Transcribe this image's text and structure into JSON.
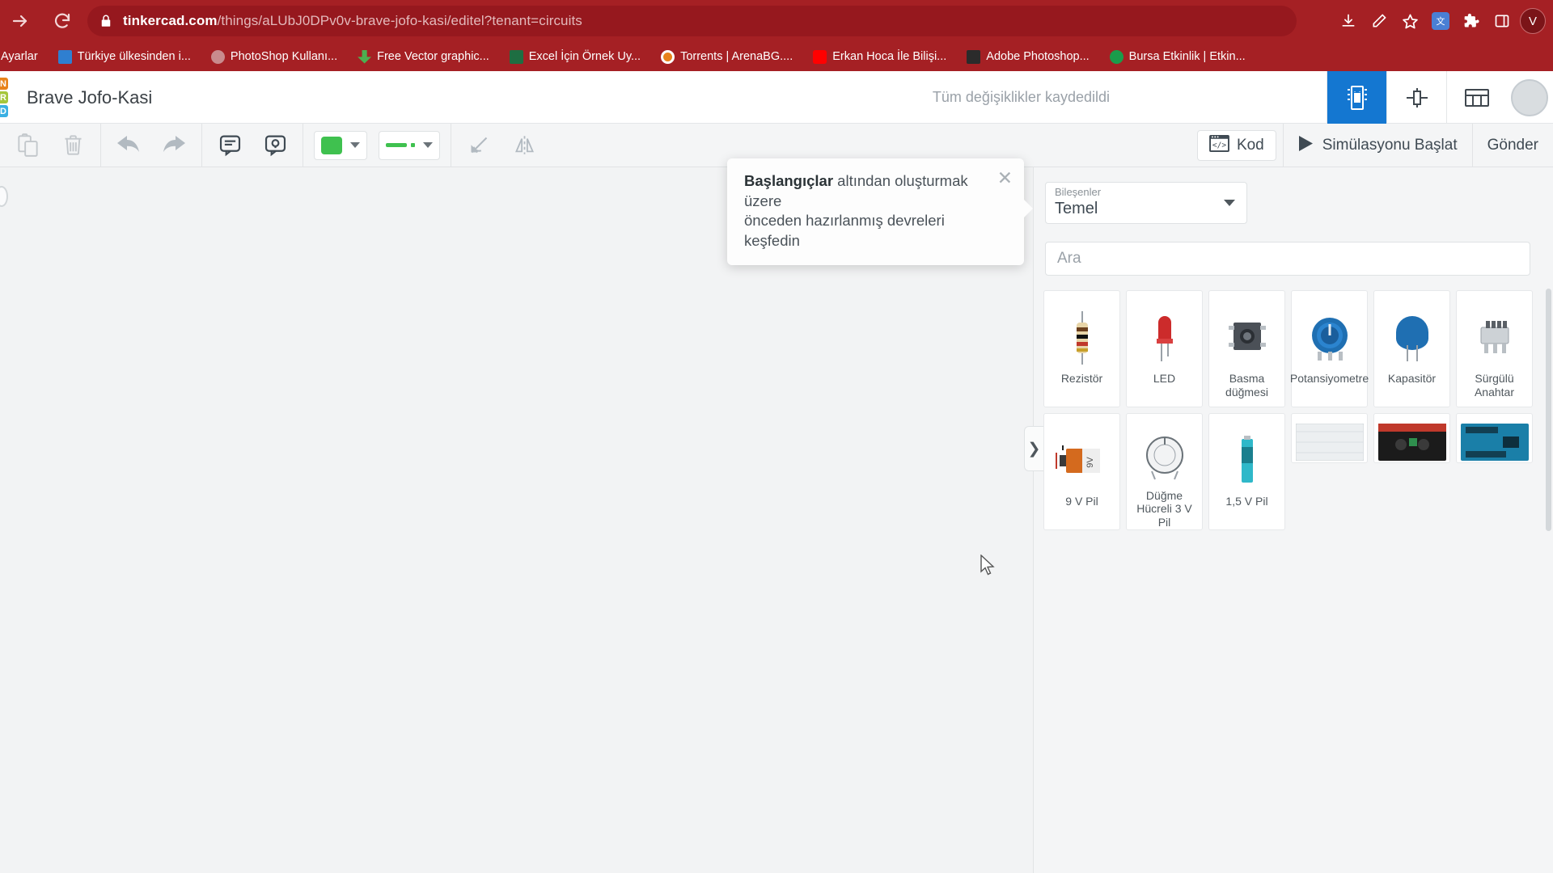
{
  "browser": {
    "url_bold": "tinkercad.com",
    "url_rest": "/things/aLUbJ0DPv0v-brave-jofo-kasi/editel?tenant=circuits",
    "forward_icon": "forward-arrow-icon",
    "reload_icon": "reload-icon",
    "lock_icon": "lock-icon",
    "profile_initial": "V",
    "toolbar_icons": [
      "download-icon",
      "edit-bookmark-icon",
      "star-icon",
      "translate-icon",
      "extensions-icon",
      "side-panel-icon"
    ],
    "bookmarks": [
      {
        "label": "Ayarlar",
        "icon": "settings-bookmark-icon",
        "color": "#a52024"
      },
      {
        "label": "Türkiye ülkesinden i...",
        "icon": "wifi-icon",
        "color": "#2f7fd0"
      },
      {
        "label": "PhotoShop Kullanı...",
        "icon": "photoshop-icon",
        "color": "#d4a0a2"
      },
      {
        "label": "Free Vector graphic...",
        "icon": "download-green-icon",
        "color": "#4caf50"
      },
      {
        "label": "Excel İçin Örnek Uy...",
        "icon": "excel-icon",
        "color": "#1e6e42"
      },
      {
        "label": "Torrents | ArenaBG....",
        "icon": "target-icon",
        "color": "#e8821a"
      },
      {
        "label": "Erkan Hoca İle Bilişi...",
        "icon": "youtube-icon",
        "color": "#ff0000"
      },
      {
        "label": "Adobe Photoshop...",
        "icon": "adobe-icon",
        "color": "#2b2b2b"
      },
      {
        "label": "Bursa Etkinlik | Etkin...",
        "icon": "globe-icon",
        "color": "#1a9c4b"
      }
    ]
  },
  "app": {
    "logo_letters": [
      "N",
      "R",
      "D"
    ],
    "logo_colors": [
      "#e8821a",
      "#a5c63b",
      "#3ab0e3"
    ],
    "doc_title": "Brave Jofo-Kasi",
    "save_status": "Tüm değişiklikler kaydedildi",
    "view_tabs": [
      {
        "name": "circuits-view",
        "icon": "breadboard-icon",
        "active": true
      },
      {
        "name": "schematic-view",
        "icon": "schematic-icon",
        "active": false
      },
      {
        "name": "list-view",
        "icon": "list-icon",
        "active": false
      }
    ]
  },
  "toolbar": {
    "left_buttons": [
      {
        "name": "copy-button",
        "icon": "copy-icon"
      },
      {
        "name": "delete-button",
        "icon": "trash-icon"
      },
      {
        "name": "undo-button",
        "icon": "undo-arrow-icon"
      },
      {
        "name": "redo-button",
        "icon": "redo-arrow-icon"
      },
      {
        "name": "note-button",
        "icon": "note-icon"
      },
      {
        "name": "comment-button",
        "icon": "comment-icon"
      }
    ],
    "color_swatch": "#3fc14f",
    "wire_color": "#3fc14f",
    "rotate_icon": "rotate-icon",
    "mirror_icon": "mirror-icon",
    "code_label": "Kod",
    "code_icon": "code-window-icon",
    "simulate_label": "Simülasyonu Başlat",
    "play_icon": "play-icon",
    "send_label": "Gönder"
  },
  "callout": {
    "bold": "Başlangıçlar",
    "line1_rest": " altından oluşturmak üzere",
    "line2": "önceden hazırlanmış devreleri",
    "line3": "keşfedin",
    "close_icon": "close-icon"
  },
  "panel": {
    "handle_icon": "chevron-right-icon",
    "dropdown_label": "Bileşenler",
    "dropdown_value": "Temel",
    "search_placeholder": "Ara",
    "search_value": "",
    "components": [
      {
        "name": "resistor",
        "label": "Rezistör",
        "art": "resistor"
      },
      {
        "name": "led",
        "label": "LED",
        "art": "led"
      },
      {
        "name": "pushbutton",
        "label": "Basma düğmesi",
        "art": "pushbutton"
      },
      {
        "name": "potentiometer",
        "label": "Potansiyometre",
        "art": "potentiometer"
      },
      {
        "name": "capacitor",
        "label": "Kapasitör",
        "art": "capacitor"
      },
      {
        "name": "slide-switch",
        "label": "Sürgülü Anahtar",
        "art": "slideswitch"
      },
      {
        "name": "battery-9v",
        "label": "9 V Pil",
        "art": "battery9v"
      },
      {
        "name": "coin-cell-3v",
        "label": "Düğme Hücreli 3 V Pil",
        "art": "coincell"
      },
      {
        "name": "battery-1-5v",
        "label": "1,5 V Pil",
        "art": "battery15"
      },
      {
        "name": "breadboard",
        "label": "",
        "art": "breadboard"
      },
      {
        "name": "microbit",
        "label": "",
        "art": "microbit"
      },
      {
        "name": "arduino",
        "label": "",
        "art": "arduino"
      }
    ]
  }
}
